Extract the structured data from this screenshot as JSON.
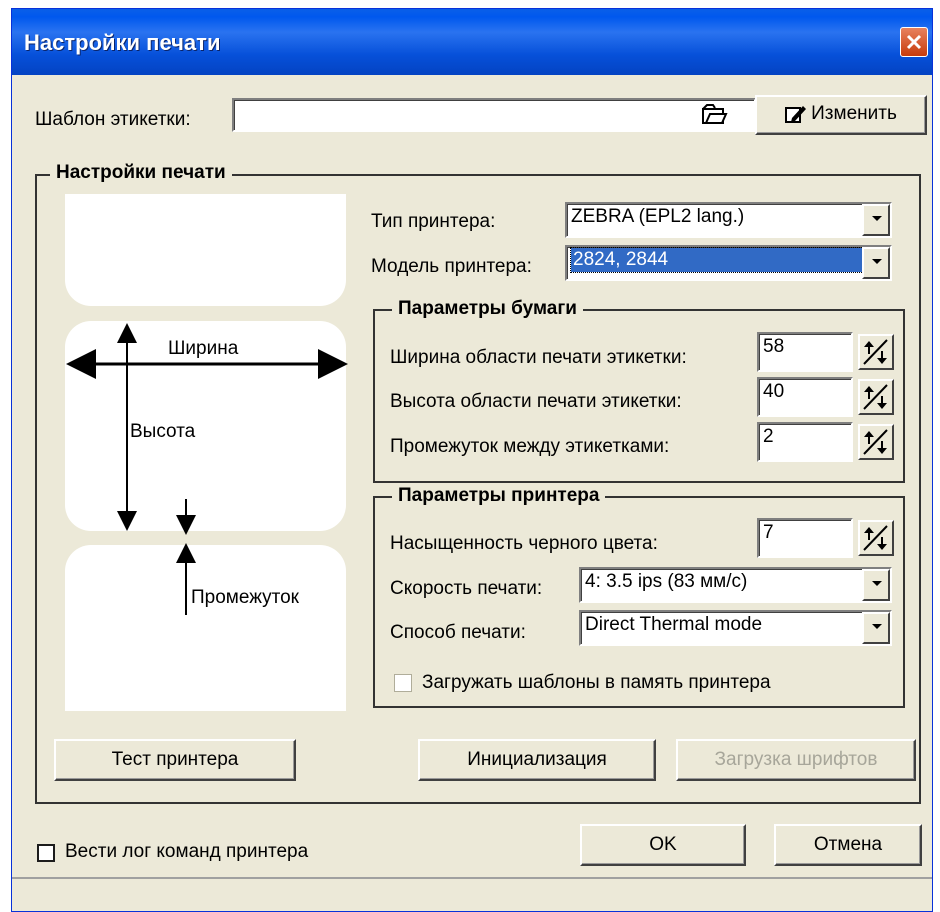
{
  "window": {
    "title": "Настройки печати"
  },
  "template": {
    "label": "Шаблон этикетки:",
    "value": "",
    "edit_button": "Изменить"
  },
  "settings_group": {
    "title": "Настройки печати",
    "printer_type_label": "Тип принтера:",
    "printer_type_value": "ZEBRA (EPL2 lang.)",
    "printer_model_label": "Модель принтера:",
    "printer_model_value": "2824, 2844"
  },
  "diagram": {
    "width_label": "Ширина",
    "height_label": "Высота",
    "gap_label": "Промежуток"
  },
  "paper_group": {
    "title": "Параметры бумаги",
    "width_label": "Ширина области печати этикетки:",
    "width_value": "58",
    "height_label": "Высота области печати этикетки:",
    "height_value": "40",
    "gap_label": "Промежуток между этикетками:",
    "gap_value": "2"
  },
  "printer_group": {
    "title": "Параметры принтера",
    "darkness_label": "Насыщенность черного цвета:",
    "darkness_value": "7",
    "speed_label": "Скорость печати:",
    "speed_value": "4: 3.5 ips (83 мм/с)",
    "mode_label": "Способ печати:",
    "mode_value": "Direct Thermal mode",
    "upload_checkbox_label": "Загружать шаблоны в память принтера",
    "upload_checked": false
  },
  "buttons": {
    "test": "Тест принтера",
    "init": "Инициализация",
    "load_fonts": "Загрузка шрифтов",
    "ok": "OK",
    "cancel": "Отмена"
  },
  "log": {
    "label": "Вести лог команд принтера",
    "checked": false
  }
}
